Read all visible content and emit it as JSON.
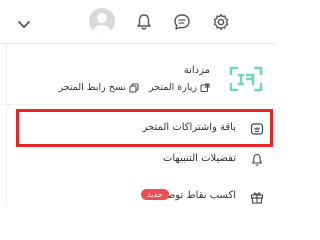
{
  "topbar": {
    "icons": [
      "chevron-down-icon",
      "avatar",
      "bell-icon",
      "chat-icon",
      "gear-icon"
    ]
  },
  "store": {
    "name": "مزدانة",
    "visit_label": "زيارة المتجر",
    "copy_link_label": "نسخ رابط المتجر"
  },
  "menu": {
    "plans_label": "باقة واشتراكات المتجر",
    "notifications_label": "تفضيلات التنبيهات",
    "referral_label": "اكسب نقاط توصية",
    "referral_badge": "جديد"
  },
  "colors": {
    "brand_green": "#74d3c3",
    "highlight": "#e8242b",
    "badge": "#f04e4e"
  }
}
